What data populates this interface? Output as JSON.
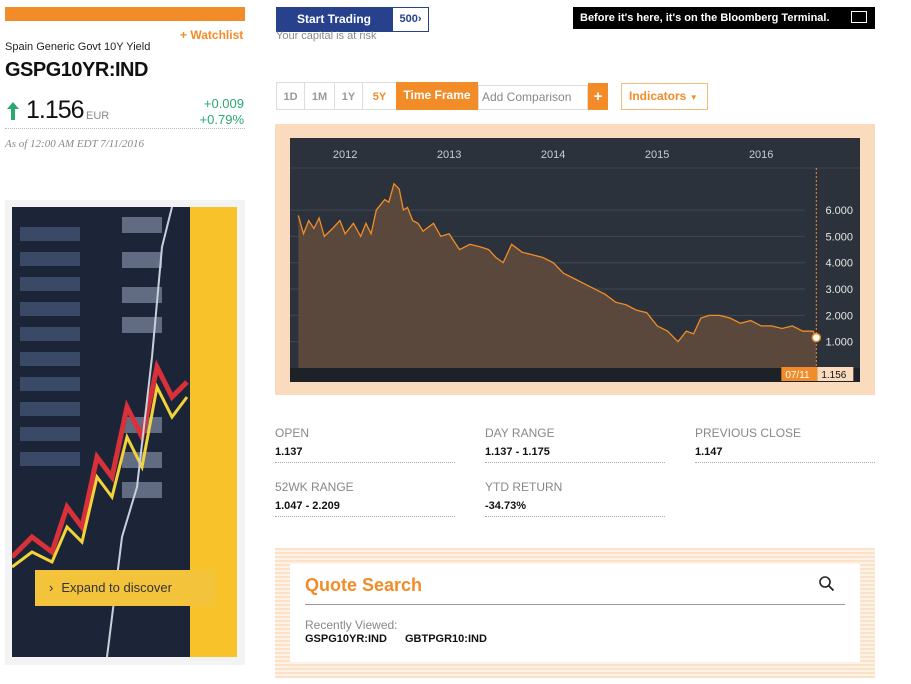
{
  "header": {
    "watchlist_label": "+ Watchlist",
    "security_name": "Spain Generic Govt 10Y Yield",
    "ticker": "GSPG10YR:IND",
    "price": "1.156",
    "currency": "EUR",
    "change_abs": "+0.009",
    "change_pct": "+0.79%",
    "as_of": "As of 12:00 AM EDT 7/11/2016",
    "change_direction_icon": "up-arrow-icon",
    "up_color": "#2aa86e"
  },
  "ad": {
    "cta_label": "Expand to discover",
    "cta_icon": "chevron-right-icon"
  },
  "promo": {
    "start_trading": "Start Trading",
    "s500_label": "500",
    "capital_risk": "Your capital is at risk",
    "bloomberg_banner": "Before it's here, it's on the Bloomberg Terminal."
  },
  "toolbar": {
    "ranges": [
      "1D",
      "1M",
      "1Y",
      "5Y"
    ],
    "active_range": "5Y",
    "time_frame_label": "Time Frame",
    "add_comparison_label": "Add Comparison",
    "add_comparison_plus": "+",
    "indicators_label": "Indicators",
    "accent_color": "#f28c28"
  },
  "chart_data": {
    "type": "area",
    "x_tick_labels": [
      "2012",
      "2013",
      "2014",
      "2015",
      "2016"
    ],
    "y_tick_labels": [
      "6.000",
      "5.000",
      "4.000",
      "3.000",
      "2.000",
      "1.000"
    ],
    "ylim": [
      0,
      7
    ],
    "grid": true,
    "last_date_label": "07/11",
    "last_value_label": "1.156",
    "series": [
      {
        "x": [
          2011.55,
          2011.6,
          2011.65,
          2011.7,
          2011.75,
          2011.8,
          2011.88,
          2011.95,
          2012.0,
          2012.08,
          2012.15,
          2012.2,
          2012.25,
          2012.3,
          2012.38,
          2012.42,
          2012.47,
          2012.52,
          2012.56,
          2012.6,
          2012.65,
          2012.7,
          2012.75,
          2012.85,
          2012.92,
          2013.0,
          2013.1,
          2013.2,
          2013.3,
          2013.38,
          2013.45,
          2013.52,
          2013.6,
          2013.7,
          2013.8,
          2013.9,
          2014.0,
          2014.1,
          2014.2,
          2014.3,
          2014.4,
          2014.5,
          2014.6,
          2014.7,
          2014.8,
          2014.9,
          2015.0,
          2015.1,
          2015.15,
          2015.2,
          2015.28,
          2015.35,
          2015.42,
          2015.5,
          2015.6,
          2015.7,
          2015.8,
          2015.9,
          2016.0,
          2016.1,
          2016.2,
          2016.3,
          2016.4,
          2016.5,
          2016.53
        ],
        "values": [
          5.8,
          5.1,
          5.6,
          5.3,
          5.7,
          5.0,
          5.3,
          5.6,
          5.1,
          5.5,
          5.0,
          5.5,
          5.1,
          6.0,
          6.4,
          6.3,
          7.0,
          6.8,
          6.0,
          6.1,
          5.6,
          5.5,
          5.2,
          5.5,
          5.0,
          5.1,
          4.5,
          4.7,
          4.6,
          4.5,
          4.2,
          4.0,
          4.7,
          4.4,
          4.3,
          4.2,
          4.0,
          3.6,
          3.4,
          3.2,
          3.0,
          2.8,
          2.5,
          2.4,
          2.2,
          2.1,
          1.6,
          1.4,
          1.2,
          1.0,
          1.4,
          1.3,
          1.9,
          2.0,
          2.0,
          1.9,
          1.7,
          1.8,
          1.6,
          1.6,
          1.5,
          1.6,
          1.4,
          1.4,
          1.156
        ]
      }
    ]
  },
  "stats": {
    "open_label": "OPEN",
    "open_value": "1.137",
    "day_range_label": "DAY RANGE",
    "day_range_value": "1.137 - 1.175",
    "prev_close_label": "PREVIOUS CLOSE",
    "prev_close_value": "1.147",
    "wk52_label": "52WK RANGE",
    "wk52_value": "1.047 - 2.209",
    "ytd_label": "YTD RETURN",
    "ytd_value": "-34.73%"
  },
  "quote_search": {
    "title": "Quote Search",
    "recently_viewed_label": "Recently Viewed:",
    "recent_items": [
      "GSPG10YR:IND",
      "GBTPGR10:IND"
    ]
  }
}
